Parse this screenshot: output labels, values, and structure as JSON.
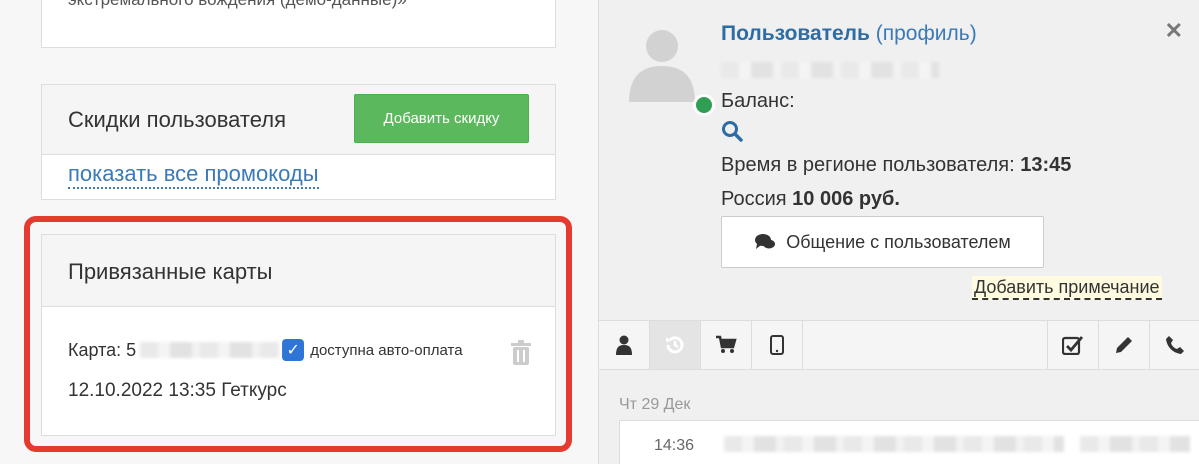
{
  "top_panel": {
    "text": "экстремального вождения (демо-данные)»"
  },
  "discounts": {
    "title": "Скидки пользователя",
    "add_button": "Добавить скидку",
    "promo_link": "показать все промокоды"
  },
  "cards": {
    "title": "Привязанные карты",
    "card_label": "Карта: 5",
    "autopay_label": "доступна авто-оплата",
    "autopay_checked": true,
    "date_line": "12.10.2022 13:35 Геткурс"
  },
  "user": {
    "name": "Пользователь",
    "profile_link": "(профиль)",
    "balance_label": "Баланс:",
    "time_label": "Время в регионе пользователя:",
    "time_value": "13:45",
    "country": "Россия",
    "amount": "10 006 руб.",
    "chat_button": "Общение с пользователем",
    "add_note": "Добавить примечание",
    "status_color": "#2f9e52"
  },
  "tabs": [
    "user-icon",
    "history-icon",
    "cart-icon",
    "mobile-icon",
    "checkbox-icon",
    "pencil-icon",
    "phone-icon"
  ],
  "feed": {
    "day": "Чт 29 Дек",
    "message_time": "14:36"
  }
}
